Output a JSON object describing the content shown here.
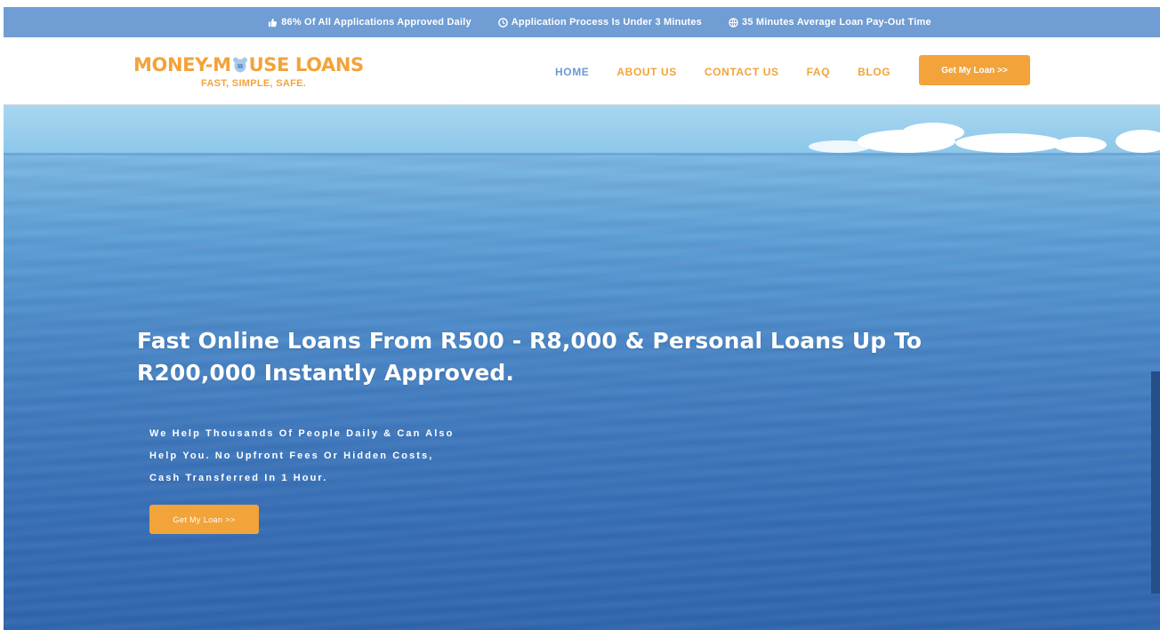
{
  "colors": {
    "accent": "#f2a33a",
    "topbar_bg": "#6f9dd4",
    "nav_active": "#6a9ad4",
    "hero_water": "#3f79bd"
  },
  "topbar": {
    "items": [
      {
        "icon": "thumbs-up-icon",
        "text": "86% Of All Applications Approved Daily"
      },
      {
        "icon": "clock-icon",
        "text": "Application Process Is Under 3 Minutes"
      },
      {
        "icon": "globe-icon",
        "text": "35 Minutes Average Loan Pay-Out Time"
      }
    ]
  },
  "header": {
    "logo": {
      "part1": "MONEY-M",
      "part2": "USE LOANS",
      "tagline": "FAST, SIMPLE, SAFE.",
      "icon": "mouse-icon"
    },
    "nav": {
      "home": "HOME",
      "about": "ABOUT US",
      "contact": "CONTACT US",
      "faq": "FAQ",
      "blog": "BLOG",
      "active": "home"
    },
    "cta": "Get My Loan >>"
  },
  "hero": {
    "title_line1": "Fast Online Loans From R500 - R8,000 & Personal Loans Up To",
    "title_line2": "R200,000 Instantly Approved.",
    "sub_line1": "We Help Thousands Of People Daily & Can Also",
    "sub_line2": "Help You. No Upfront Fees Or Hidden Costs,",
    "sub_line3": "Cash Transferred In 1 Hour.",
    "cta": "Get My Loan >>"
  }
}
